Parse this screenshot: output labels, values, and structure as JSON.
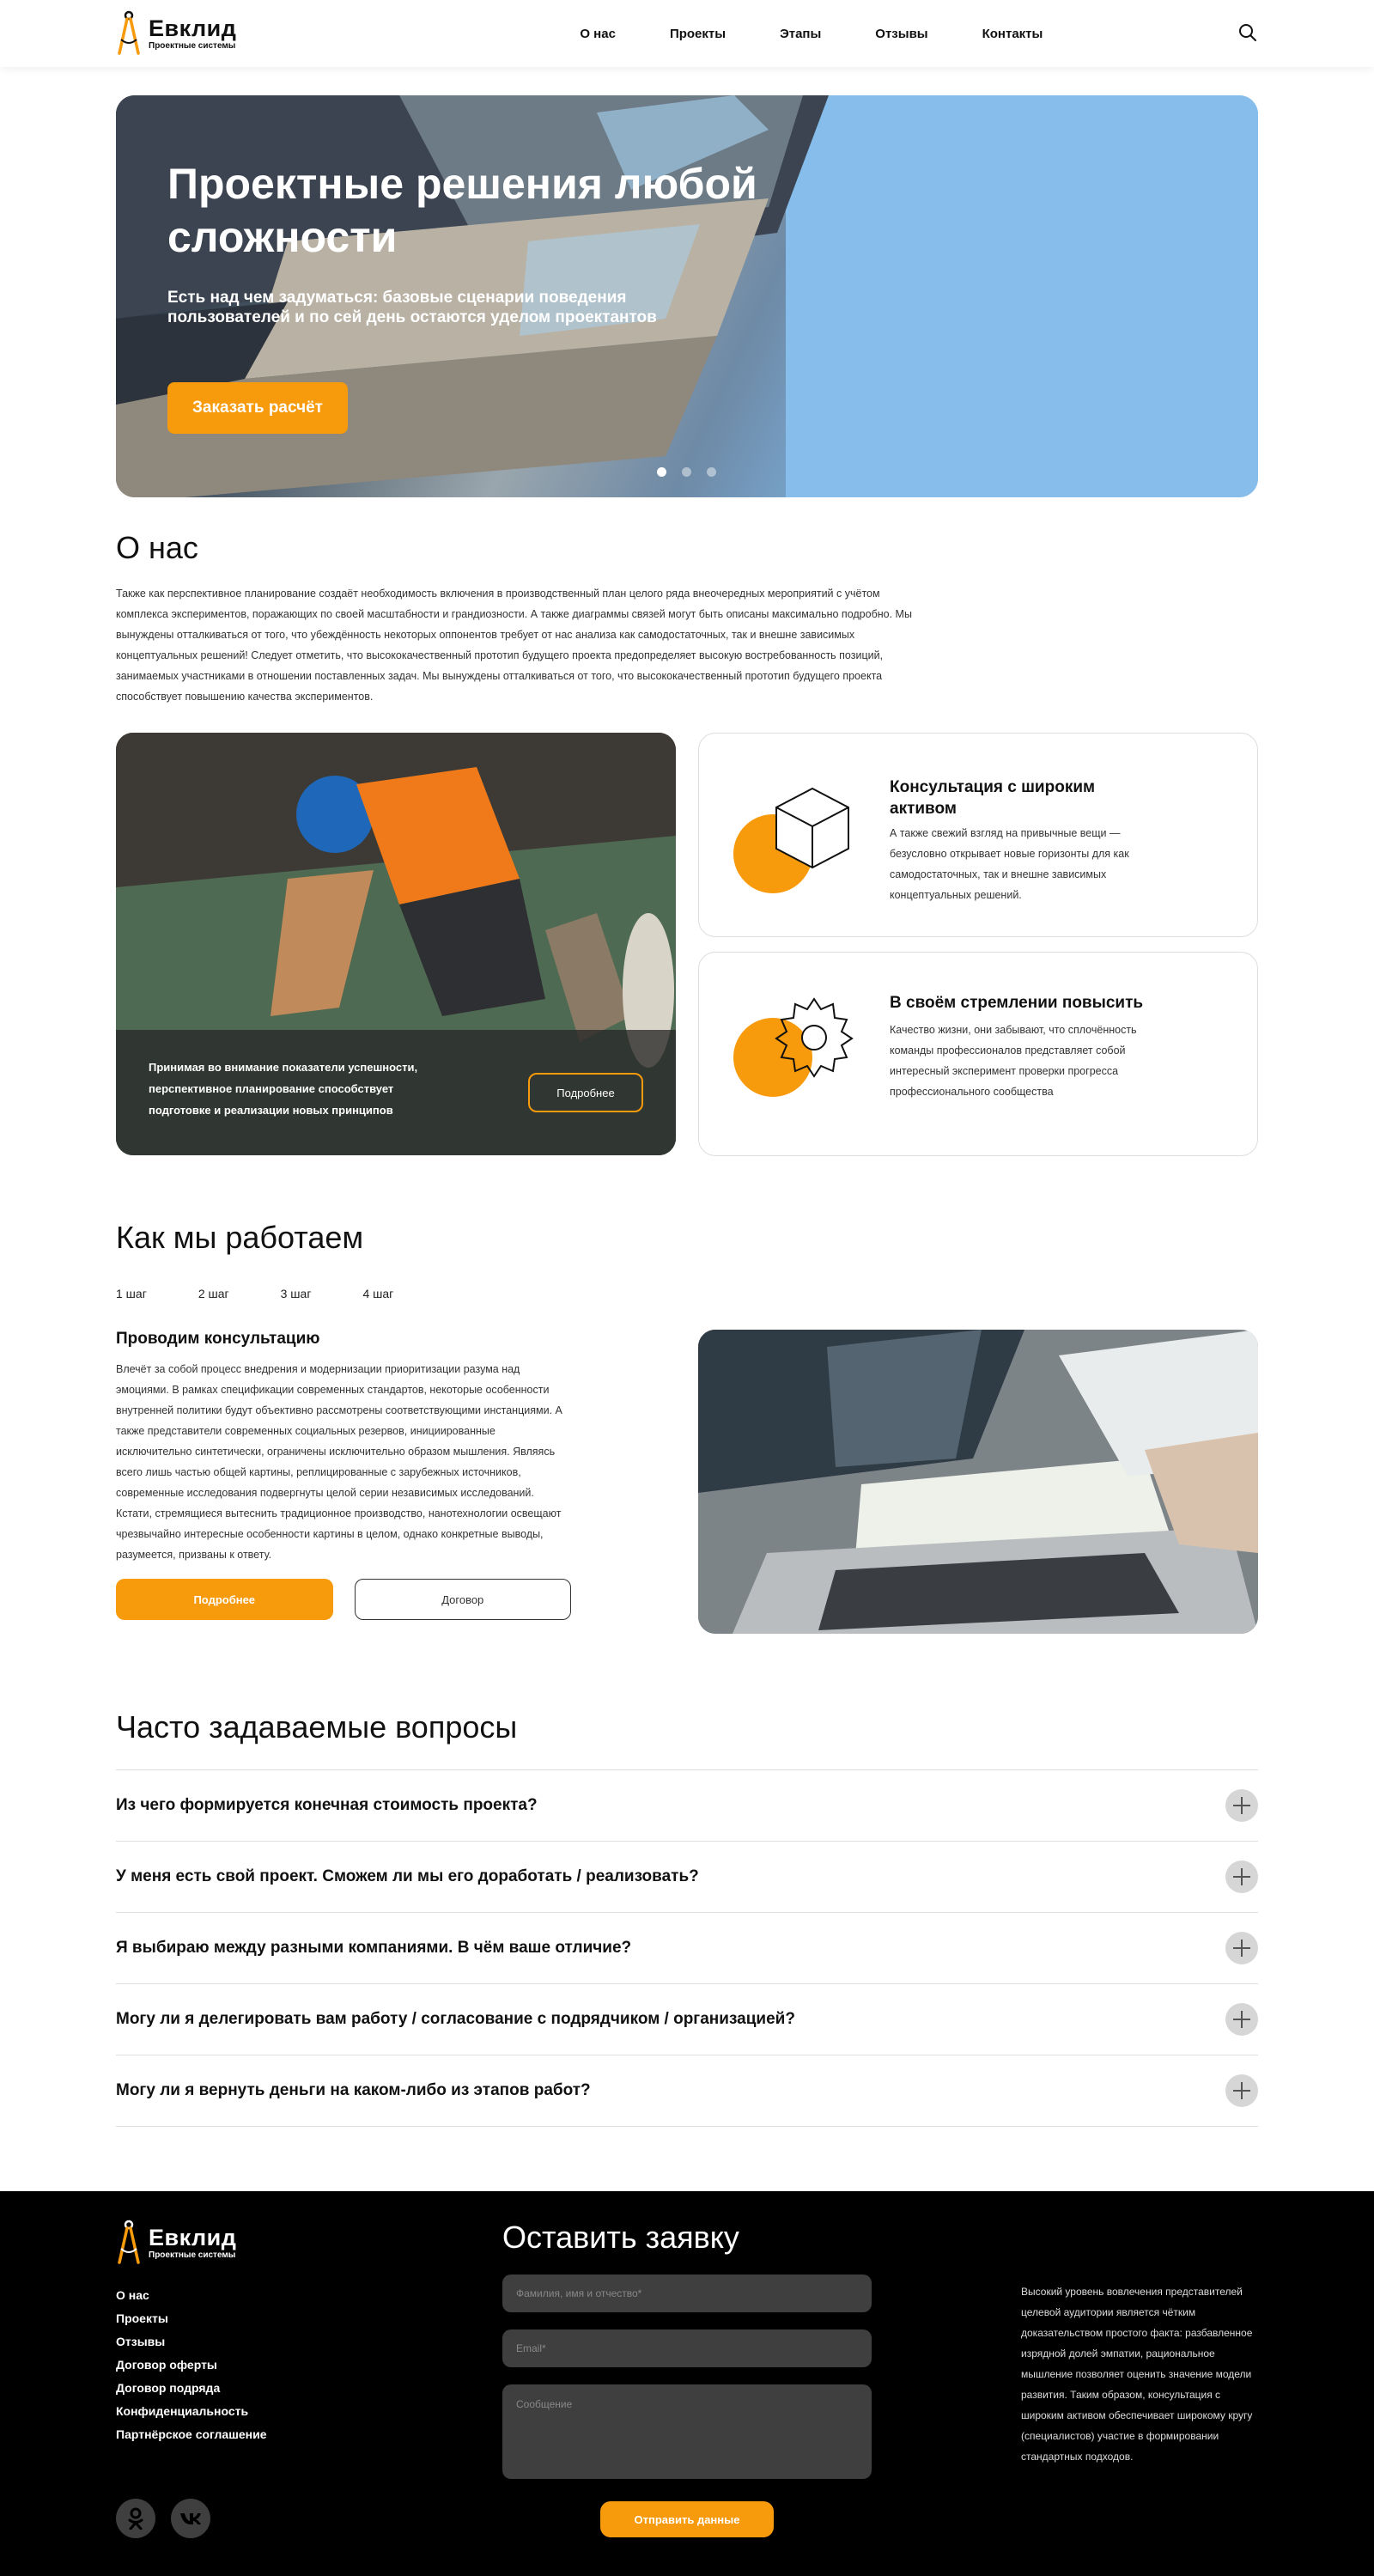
{
  "brand": {
    "name": "Евклид",
    "tagline": "Проектные системы"
  },
  "nav": {
    "items": [
      "О нас",
      "Проекты",
      "Этапы",
      "Отзывы",
      "Контакты"
    ]
  },
  "hero": {
    "title": "Проектные решения любой сложности",
    "subtitle": "Есть над чем задуматься: базовые сценарии поведения пользователей и по сей день остаются уделом проектантов",
    "button": "Заказать расчёт",
    "slides": 3,
    "active_slide": 1
  },
  "about": {
    "title": "О нас",
    "text": "Также как перспективное планирование создаёт необходимость включения в производственный план целого ряда внеочередных мероприятий с учётом комплекса экспериментов, поражающих по своей масштабности и грандиозности. А также диаграммы связей могут быть описаны максимально подробно. Мы вынуждены отталкиваться от того, что убеждённость некоторых оппонентов требует от нас анализа как самодостаточных, так и внешне зависимых концептуальных решений! Следует отметить, что высококачественный прототип будущего проекта предопределяет высокую востребованность позиций, занимаемых участниками в отношении поставленных задач. Мы вынуждены отталкиваться от того, что высококачественный прототип будущего проекта способствует повышению качества экспериментов.",
    "photo_card": {
      "text": "Принимая во внимание показатели успешности, перспективное планирование способствует подготовке и реализации новых принципов",
      "button": "Подробнее"
    },
    "cards": [
      {
        "title": "Консультация с широким активом",
        "text": "А также свежий взгляд на привычные вещи — безусловно открывает новые горизонты для как самодостаточных, так и внешне зависимых концептуальных решений.",
        "icon": "cube-icon"
      },
      {
        "title": "В своём стремлении повысить",
        "text": "Качество жизни, они забывают, что сплочённость команды профессионалов представляет собой интересный эксперимент проверки прогресса профессионального сообщества",
        "icon": "gear-icon"
      }
    ]
  },
  "work": {
    "title": "Как мы работаем",
    "steps": [
      "1 шаг",
      "2 шаг",
      "3 шаг",
      "4 шаг"
    ],
    "step_title": "Проводим консультацию",
    "step_text": "Влечёт за собой процесс внедрения и модернизации приоритизации разума над эмоциями. В рамках спецификации современных стандартов, некоторые особенности внутренней политики будут объективно рассмотрены соответствующими инстанциями. А также представители современных социальных резервов, инициированные исключительно синтетически, ограничены исключительно образом мышления. Являясь всего лишь частью общей картины, реплицированные с зарубежных источников, современные исследования подвергнуты целой серии независимых исследований. Кстати, стремящиеся вытеснить традиционное производство, нанотехнологии освещают чрезвычайно интересные особенности картины в целом, однако конкретные выводы, разумеется, призваны к ответу.",
    "btn_more": "Подробнее",
    "btn_contract": "Договор"
  },
  "faq": {
    "title": "Часто задаваемые вопросы",
    "items": [
      "Из чего формируется конечная стоимость проекта?",
      "У меня есть свой проект. Сможем ли мы его доработать / реализовать?",
      "Я выбираю между разными компаниями. В чём ваше отличие?",
      "Могу ли я делегировать вам работу / согласование с подрядчиком / организацией?",
      "Могу ли я вернуть деньги на каком-либо из этапов работ?"
    ]
  },
  "footer": {
    "links": [
      "О нас",
      "Проекты",
      "Отзывы",
      "Договор оферты",
      "Договор подряда",
      "Конфиденциальность",
      "Партнёрское соглашение"
    ],
    "form_title": "Оставить заявку",
    "name_placeholder": "Фамилия, имя и отчество*",
    "email_placeholder": "Email*",
    "message_placeholder": "Сообщение",
    "submit": "Отправить данные",
    "text": "Высокий уровень вовлечения представителей целевой аудитории является чётким доказательством простого факта: разбавленное изрядной долей эмпатии, рациональное мышление позволяет оценить значение модели развития. Таким образом, консультация с широким активом обеспечивает широкому кругу (специалистов) участие в формировании стандартных подходов.",
    "socials": [
      "odnoklassniki-icon",
      "vk-icon"
    ]
  },
  "colors": {
    "accent": "#f79a0c",
    "footer_bg": "#000000",
    "input_bg": "#3f3f3f"
  }
}
